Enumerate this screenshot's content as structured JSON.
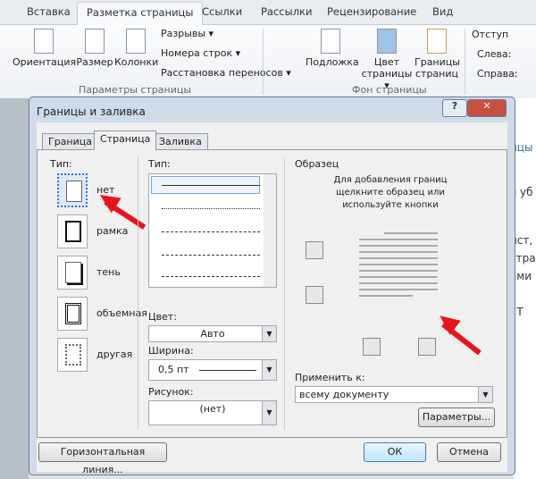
{
  "ribbon": {
    "tabs": [
      "Вставка",
      "Разметка страницы",
      "Ссылки",
      "Рассылки",
      "Рецензирование",
      "Вид"
    ],
    "orientation": "Ориентация",
    "size": "Размер",
    "columns": "Колонки",
    "breaks": "Разрывы ▾",
    "line_numbers": "Номера строк ▾",
    "hyphenation": "Расстановка переносов ▾",
    "group_page_setup": "Параметры страницы",
    "watermark": "Подложка",
    "page_color": "Цвет страницы ▾",
    "page_borders": "Границы страниц",
    "group_page_bg": "Фон страницы",
    "indent": "Отступ",
    "left": "Слева:",
    "right": "Справа:"
  },
  "document": {
    "fragments": [
      "ицы",
      "я уб",
      "ист,",
      "стра",
      "ями",
      "«Т"
    ]
  },
  "dialog": {
    "title": "Границы и заливка",
    "help": "?",
    "close": "✕",
    "tabs": [
      "Граница",
      "Страница",
      "Заливка"
    ],
    "setting_label": "Тип:",
    "settings": [
      "нет",
      "рамка",
      "тень",
      "объемная",
      "другая"
    ],
    "style_label": "Тип:",
    "color_label": "Цвет:",
    "color_value": "Авто",
    "width_label": "Ширина:",
    "width_value": "0,5 пт",
    "art_label": "Рисунок:",
    "art_value": "(нет)",
    "preview_label": "Образец",
    "preview_hint": "Для добавления границ щелкните образец или используйте кнопки",
    "apply_label": "Применить к:",
    "apply_value": "всему документу",
    "options": "Параметры...",
    "horizontal_line": "Горизонтальная линия...",
    "ok": "ОК",
    "cancel": "Отмена"
  },
  "colors": {
    "annotation_arrow": "#e8141c",
    "selection": "#3a76c8"
  }
}
